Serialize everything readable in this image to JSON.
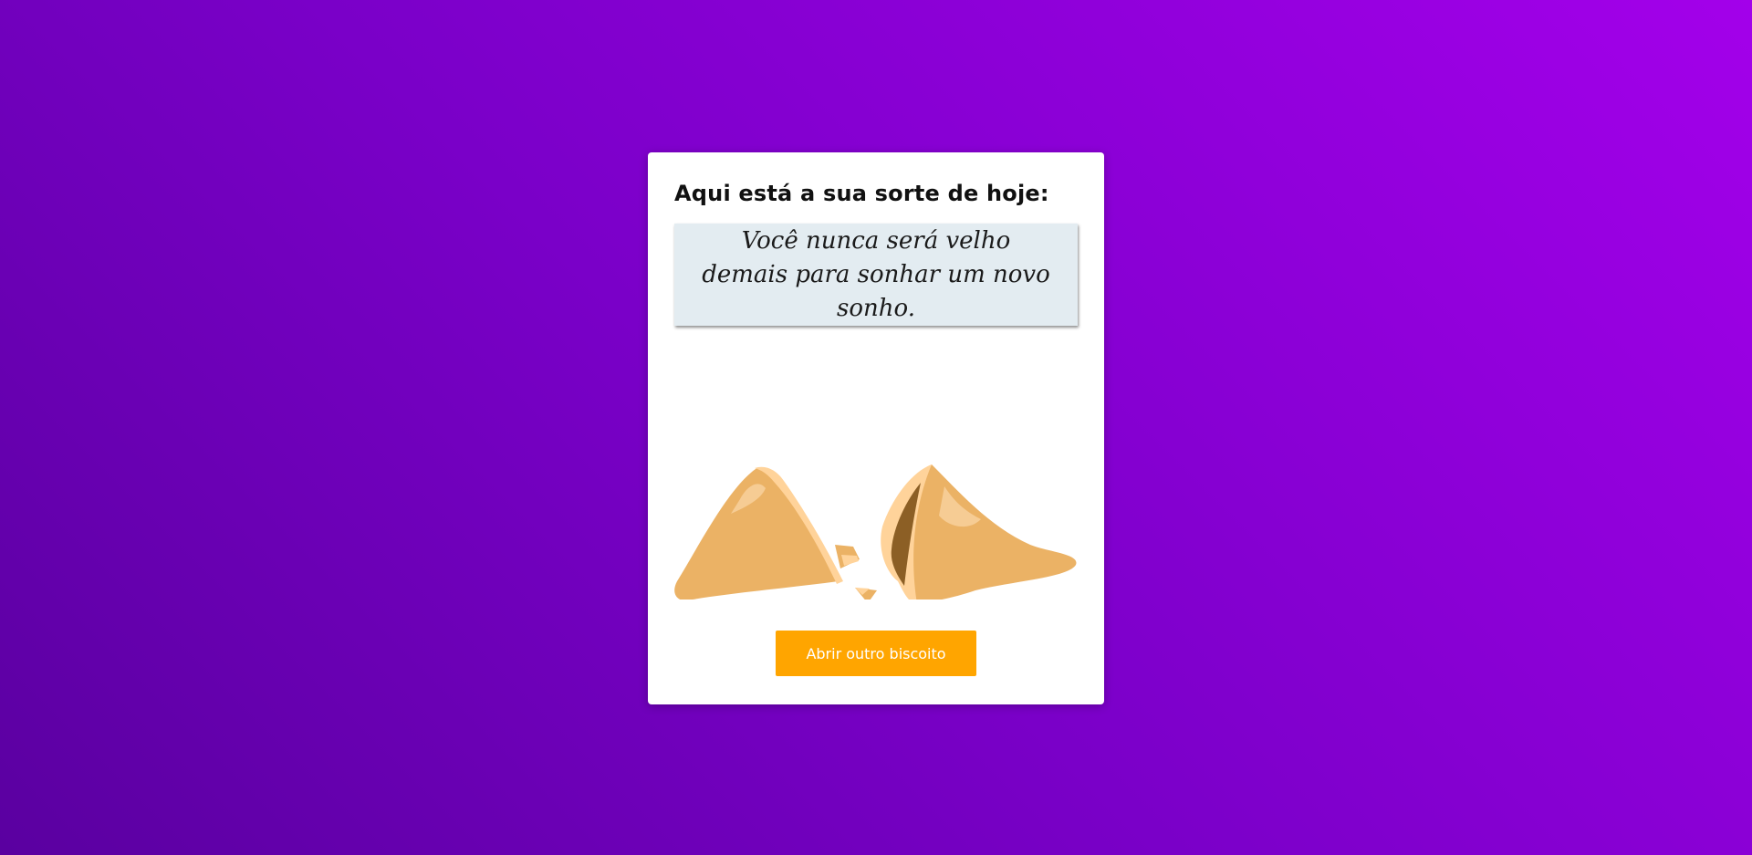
{
  "card": {
    "title": "Aqui está a sua sorte de hoje:",
    "fortune": "Você nunca será velho demais para sonhar um novo sonho.",
    "image": "broken-fortune-cookie-illustration",
    "button_label": "Abrir outro biscoito"
  },
  "colors": {
    "background_start": "#5a00a0",
    "background_end": "#a300ea",
    "card": "#ffffff",
    "fortune_box": "#e3ecf1",
    "button": "#ffa500",
    "cookie_main": "#ebb265",
    "cookie_light": "#ffd39a",
    "cookie_dark": "#8c5f25"
  }
}
